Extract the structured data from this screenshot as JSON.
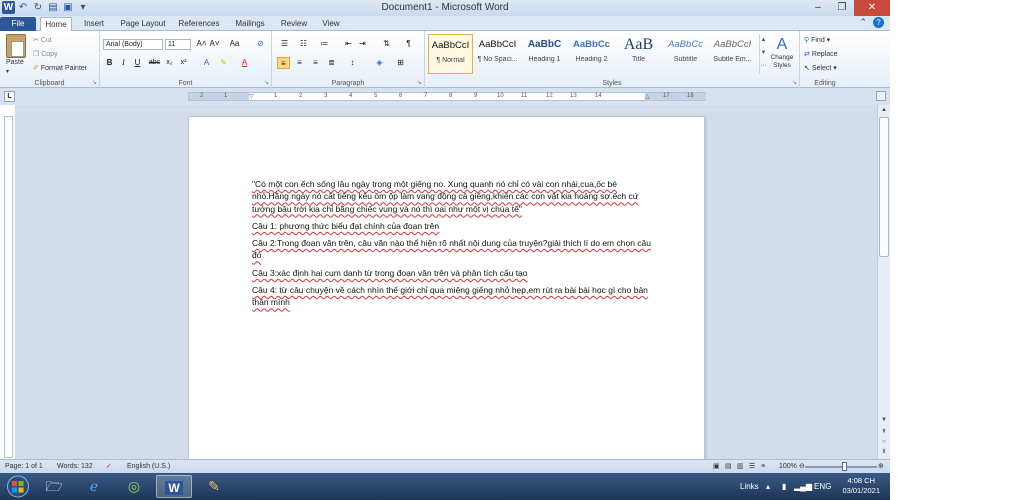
{
  "titlebar": {
    "title": "Document1 - Microsoft Word",
    "word_icon": "W",
    "min": "–",
    "restore": "❐",
    "close": "✕"
  },
  "tabs": [
    "File",
    "Home",
    "Insert",
    "Page Layout",
    "References",
    "Mailings",
    "Review",
    "View"
  ],
  "ribbon": {
    "clipboard": {
      "label": "Clipboard",
      "paste": "Paste",
      "cut": "Cut",
      "copy": "Copy",
      "format_painter": "Format Painter"
    },
    "font": {
      "label": "Font",
      "font_name": "Arial (Body)",
      "font_size": "11"
    },
    "paragraph": {
      "label": "Paragraph"
    },
    "styles": {
      "label": "Styles",
      "items": [
        {
          "sample": "AaBbCcI",
          "name": "¶ Normal"
        },
        {
          "sample": "AaBbCcI",
          "name": "¶ No Spaci..."
        },
        {
          "sample": "AaBbC",
          "name": "Heading 1"
        },
        {
          "sample": "AaBbCc",
          "name": "Heading 2"
        },
        {
          "sample": "AaB",
          "name": "Title"
        },
        {
          "sample": "AaBbCc",
          "name": "Subtitle"
        },
        {
          "sample": "AaBbCcI",
          "name": "Subtle Em..."
        }
      ],
      "change_styles": "Change Styles"
    },
    "editing": {
      "label": "Editing",
      "find": "Find",
      "replace": "Replace",
      "select": "Select"
    }
  },
  "ruler": {
    "corner": "L",
    "ticks": [
      "2",
      "1",
      "1",
      "2",
      "3",
      "4",
      "5",
      "6",
      "7",
      "8",
      "9",
      "10",
      "11",
      "12",
      "13",
      "14",
      "15",
      "17",
      "18"
    ]
  },
  "document": {
    "paragraphs": [
      "\"Có một con ếch sống lâu ngày trong một giếng no. Xung quanh nó chỉ có vài con nhái,cua,ốc bé nhỏ.Hằng ngày nó cất tiếng kêu ồm ộp làm vang động cả giếng,khiến các con vật kia hoảng sợ.ếch cứ tưởng bầu trời kia chỉ bằng chiếc vung và nó thì oai như một vị chúa tể\"",
      "Câu 1: phương thức biểu đạt chính của đoạn trên",
      "Câu 2:Trong đoạn văn trên, câu văn nào thể hiện  rõ nhất nội dung của truyện?giải thích lí do em chọn câu đó",
      "Câu 3:xác định hai cum danh từ trong đoạn văn trên và phân tích cấu tạo",
      "Câu 4: từ câu chuyện về cách nhìn thế giới chỉ qua miệng giếng nhỏ hẹp,em rút ra bài bài học gì cho bản thân mình"
    ]
  },
  "statusbar": {
    "page": "Page: 1 of 1",
    "words": "Words: 132",
    "language": "English (U.S.)",
    "zoom": "100%"
  },
  "taskbar": {
    "links": "Links",
    "lang": "ENG",
    "time": "4:08 CH",
    "date": "03/01/2021"
  }
}
